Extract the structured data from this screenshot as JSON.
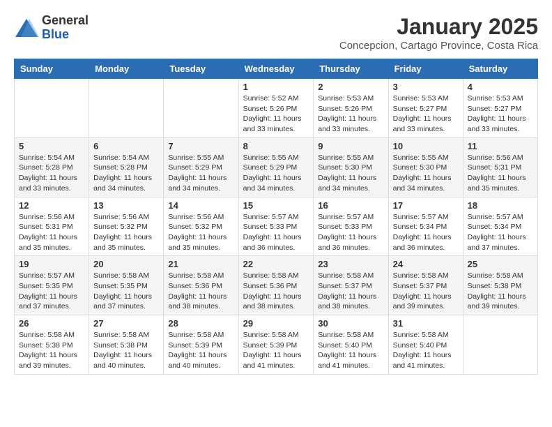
{
  "header": {
    "logo_general": "General",
    "logo_blue": "Blue",
    "month_year": "January 2025",
    "location": "Concepcion, Cartago Province, Costa Rica"
  },
  "days_of_week": [
    "Sunday",
    "Monday",
    "Tuesday",
    "Wednesday",
    "Thursday",
    "Friday",
    "Saturday"
  ],
  "weeks": [
    [
      {
        "day": "",
        "info": ""
      },
      {
        "day": "",
        "info": ""
      },
      {
        "day": "",
        "info": ""
      },
      {
        "day": "1",
        "info": "Sunrise: 5:52 AM\nSunset: 5:26 PM\nDaylight: 11 hours\nand 33 minutes."
      },
      {
        "day": "2",
        "info": "Sunrise: 5:53 AM\nSunset: 5:26 PM\nDaylight: 11 hours\nand 33 minutes."
      },
      {
        "day": "3",
        "info": "Sunrise: 5:53 AM\nSunset: 5:27 PM\nDaylight: 11 hours\nand 33 minutes."
      },
      {
        "day": "4",
        "info": "Sunrise: 5:53 AM\nSunset: 5:27 PM\nDaylight: 11 hours\nand 33 minutes."
      }
    ],
    [
      {
        "day": "5",
        "info": "Sunrise: 5:54 AM\nSunset: 5:28 PM\nDaylight: 11 hours\nand 33 minutes."
      },
      {
        "day": "6",
        "info": "Sunrise: 5:54 AM\nSunset: 5:28 PM\nDaylight: 11 hours\nand 34 minutes."
      },
      {
        "day": "7",
        "info": "Sunrise: 5:55 AM\nSunset: 5:29 PM\nDaylight: 11 hours\nand 34 minutes."
      },
      {
        "day": "8",
        "info": "Sunrise: 5:55 AM\nSunset: 5:29 PM\nDaylight: 11 hours\nand 34 minutes."
      },
      {
        "day": "9",
        "info": "Sunrise: 5:55 AM\nSunset: 5:30 PM\nDaylight: 11 hours\nand 34 minutes."
      },
      {
        "day": "10",
        "info": "Sunrise: 5:55 AM\nSunset: 5:30 PM\nDaylight: 11 hours\nand 34 minutes."
      },
      {
        "day": "11",
        "info": "Sunrise: 5:56 AM\nSunset: 5:31 PM\nDaylight: 11 hours\nand 35 minutes."
      }
    ],
    [
      {
        "day": "12",
        "info": "Sunrise: 5:56 AM\nSunset: 5:31 PM\nDaylight: 11 hours\nand 35 minutes."
      },
      {
        "day": "13",
        "info": "Sunrise: 5:56 AM\nSunset: 5:32 PM\nDaylight: 11 hours\nand 35 minutes."
      },
      {
        "day": "14",
        "info": "Sunrise: 5:56 AM\nSunset: 5:32 PM\nDaylight: 11 hours\nand 35 minutes."
      },
      {
        "day": "15",
        "info": "Sunrise: 5:57 AM\nSunset: 5:33 PM\nDaylight: 11 hours\nand 36 minutes."
      },
      {
        "day": "16",
        "info": "Sunrise: 5:57 AM\nSunset: 5:33 PM\nDaylight: 11 hours\nand 36 minutes."
      },
      {
        "day": "17",
        "info": "Sunrise: 5:57 AM\nSunset: 5:34 PM\nDaylight: 11 hours\nand 36 minutes."
      },
      {
        "day": "18",
        "info": "Sunrise: 5:57 AM\nSunset: 5:34 PM\nDaylight: 11 hours\nand 37 minutes."
      }
    ],
    [
      {
        "day": "19",
        "info": "Sunrise: 5:57 AM\nSunset: 5:35 PM\nDaylight: 11 hours\nand 37 minutes."
      },
      {
        "day": "20",
        "info": "Sunrise: 5:58 AM\nSunset: 5:35 PM\nDaylight: 11 hours\nand 37 minutes."
      },
      {
        "day": "21",
        "info": "Sunrise: 5:58 AM\nSunset: 5:36 PM\nDaylight: 11 hours\nand 38 minutes."
      },
      {
        "day": "22",
        "info": "Sunrise: 5:58 AM\nSunset: 5:36 PM\nDaylight: 11 hours\nand 38 minutes."
      },
      {
        "day": "23",
        "info": "Sunrise: 5:58 AM\nSunset: 5:37 PM\nDaylight: 11 hours\nand 38 minutes."
      },
      {
        "day": "24",
        "info": "Sunrise: 5:58 AM\nSunset: 5:37 PM\nDaylight: 11 hours\nand 39 minutes."
      },
      {
        "day": "25",
        "info": "Sunrise: 5:58 AM\nSunset: 5:38 PM\nDaylight: 11 hours\nand 39 minutes."
      }
    ],
    [
      {
        "day": "26",
        "info": "Sunrise: 5:58 AM\nSunset: 5:38 PM\nDaylight: 11 hours\nand 39 minutes."
      },
      {
        "day": "27",
        "info": "Sunrise: 5:58 AM\nSunset: 5:38 PM\nDaylight: 11 hours\nand 40 minutes."
      },
      {
        "day": "28",
        "info": "Sunrise: 5:58 AM\nSunset: 5:39 PM\nDaylight: 11 hours\nand 40 minutes."
      },
      {
        "day": "29",
        "info": "Sunrise: 5:58 AM\nSunset: 5:39 PM\nDaylight: 11 hours\nand 41 minutes."
      },
      {
        "day": "30",
        "info": "Sunrise: 5:58 AM\nSunset: 5:40 PM\nDaylight: 11 hours\nand 41 minutes."
      },
      {
        "day": "31",
        "info": "Sunrise: 5:58 AM\nSunset: 5:40 PM\nDaylight: 11 hours\nand 41 minutes."
      },
      {
        "day": "",
        "info": ""
      }
    ]
  ]
}
